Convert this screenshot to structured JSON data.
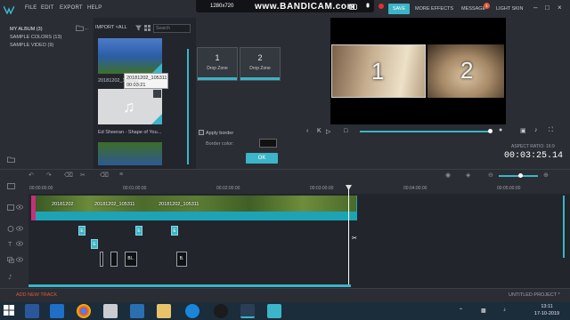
{
  "menu": [
    "FILE",
    "EDIT",
    "EXPORT",
    "HELP"
  ],
  "recorder": {
    "resolution": "1280x720",
    "brand": "www.BANDICAM.com"
  },
  "header": {
    "save": "SAVE",
    "more_effects": "MORE EFFECTS",
    "message": "MESSAGE",
    "message_count": "1",
    "light_skin": "LIGHT SKIN"
  },
  "albums": [
    "MY ALBUM (3)",
    "SAMPLE COLORS (13)",
    "SAMPLE VIDEO (9)"
  ],
  "media": {
    "import": "IMPORT ˅ALL",
    "search_placeholder": "Search",
    "tooltip_name": "20181202_105311",
    "tooltip_duration": "00:03:21",
    "caption1": "20181202_105311",
    "caption2": "Ed Sheeran - Shape of You..."
  },
  "dropzones": [
    {
      "num": "1",
      "label": "Drop Zone"
    },
    {
      "num": "2",
      "label": "Drop Zone"
    }
  ],
  "options": {
    "apply_border": "Apply border",
    "border_color": "Border color:",
    "ok": "OK"
  },
  "preview": {
    "num1": "1",
    "num2": "2",
    "aspect": "ASPECT RATIO: 16:9",
    "timecode": "00:03:25.14"
  },
  "ruler": [
    "00:00:00:00",
    "00:01:00:00",
    "00:02:00:00",
    "00:03:00:00",
    "00:04:00:00",
    "00:05:00:00"
  ],
  "clips": [
    "20181202",
    "20181202_105311",
    "20181202_105311"
  ],
  "tiles": [
    "Bl..",
    "B."
  ],
  "footer": {
    "add_track": "ADD NEW TRACK",
    "project": "UNTITLED PROJECT *"
  },
  "clock": {
    "time": "13:11",
    "date": "17-10-2019"
  },
  "colors": {
    "accent": "#3bb5c7",
    "alert": "#e05a3a",
    "bg": "#22252b"
  }
}
